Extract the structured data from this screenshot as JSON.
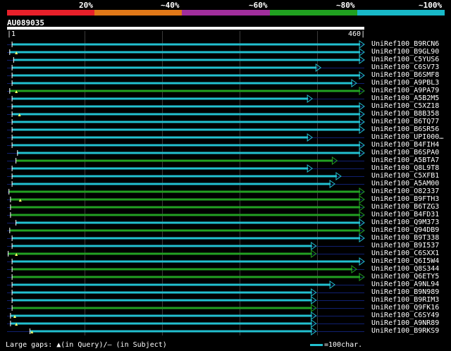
{
  "legend": {
    "segments": [
      {
        "color": "#e8202a"
      },
      {
        "color": "#e07818"
      },
      {
        "color": "#a02e9c"
      },
      {
        "color": "#20a020"
      },
      {
        "color": "#18b8c8"
      }
    ],
    "labels": [
      "20%",
      "~40%",
      "~60%",
      "~80%",
      "~100%"
    ]
  },
  "query": {
    "id": "AU089035",
    "start_label": "1",
    "end_label": "460",
    "length": 460
  },
  "colors": {
    "cyan": "#22c0d0",
    "green": "#22a022",
    "row_line": "#102070",
    "background": "#000000"
  },
  "hits": [
    {
      "label": "UniRef100_B9RCN6",
      "start": 6,
      "end": 460,
      "color": "cyan",
      "arrow": true,
      "gap_q": null
    },
    {
      "label": "UniRef100_B9GL90",
      "start": 3,
      "end": 460,
      "color": "cyan",
      "arrow": true,
      "gap_q": 12
    },
    {
      "label": "UniRef100_C5YUS6",
      "start": 8,
      "end": 460,
      "color": "cyan",
      "arrow": true,
      "gap_q": null
    },
    {
      "label": "UniRef100_C6SV73",
      "start": 6,
      "end": 404,
      "color": "cyan",
      "arrow": true,
      "gap_q": null
    },
    {
      "label": "UniRef100_B6SMF8",
      "start": 6,
      "end": 460,
      "color": "cyan",
      "arrow": true,
      "gap_q": null
    },
    {
      "label": "UniRef100_A9PBL3",
      "start": 6,
      "end": 450,
      "color": "cyan",
      "arrow": true,
      "gap_q": null
    },
    {
      "label": "UniRef100_A9PA79",
      "start": 3,
      "end": 460,
      "color": "green",
      "arrow": true,
      "gap_q": 12
    },
    {
      "label": "UniRef100_A5B2M5",
      "start": 6,
      "end": 393,
      "color": "cyan",
      "arrow": true,
      "gap_q": null
    },
    {
      "label": "UniRef100_C5XZ18",
      "start": 6,
      "end": 460,
      "color": "cyan",
      "arrow": true,
      "gap_q": null
    },
    {
      "label": "UniRef100_B8B358",
      "start": 6,
      "end": 460,
      "color": "cyan",
      "arrow": true,
      "gap_q": 16
    },
    {
      "label": "UniRef100_B6TQ77",
      "start": 6,
      "end": 460,
      "color": "cyan",
      "arrow": true,
      "gap_q": null
    },
    {
      "label": "UniRef100_B6SR56",
      "start": 6,
      "end": 460,
      "color": "cyan",
      "arrow": true,
      "gap_q": null
    },
    {
      "label": "UniRef100_UPI000…",
      "start": 6,
      "end": 393,
      "color": "cyan",
      "arrow": true,
      "gap_q": null
    },
    {
      "label": "UniRef100_B4FIH4",
      "start": 6,
      "end": 460,
      "color": "cyan",
      "arrow": true,
      "gap_q": null
    },
    {
      "label": "UniRef100_B6SPA0",
      "start": 13,
      "end": 460,
      "color": "cyan",
      "arrow": true,
      "gap_q": null
    },
    {
      "label": "UniRef100_A5BTA7",
      "start": 11,
      "end": 425,
      "color": "green",
      "arrow": true,
      "gap_q": null
    },
    {
      "label": "UniRef100_Q8L9T8",
      "start": 6,
      "end": 393,
      "color": "cyan",
      "arrow": true,
      "gap_q": null
    },
    {
      "label": "UniRef100_C5XFB1",
      "start": 6,
      "end": 430,
      "color": "cyan",
      "arrow": true,
      "gap_q": null
    },
    {
      "label": "UniRef100_A5AM00",
      "start": 6,
      "end": 422,
      "color": "cyan",
      "arrow": true,
      "gap_q": null
    },
    {
      "label": "UniRef100_O82337",
      "start": 2,
      "end": 460,
      "color": "green",
      "arrow": true,
      "gap_q": null
    },
    {
      "label": "UniRef100_B9FTH3",
      "start": 4,
      "end": 460,
      "color": "green",
      "arrow": true,
      "gap_q": 17
    },
    {
      "label": "UniRef100_B6TZG3",
      "start": 4,
      "end": 460,
      "color": "green",
      "arrow": true,
      "gap_q": null
    },
    {
      "label": "UniRef100_B4FD31",
      "start": 4,
      "end": 460,
      "color": "green",
      "arrow": true,
      "gap_q": null
    },
    {
      "label": "UniRef100_Q9M373",
      "start": 11,
      "end": 460,
      "color": "cyan",
      "arrow": true,
      "gap_q": null
    },
    {
      "label": "UniRef100_Q94DB9",
      "start": 3,
      "end": 460,
      "color": "green",
      "arrow": true,
      "gap_q": null
    },
    {
      "label": "UniRef100_B9T338",
      "start": 6,
      "end": 460,
      "color": "cyan",
      "arrow": true,
      "gap_q": null
    },
    {
      "label": "UniRef100_B9I537",
      "start": 6,
      "end": 398,
      "color": "cyan",
      "arrow": true,
      "gap_q": null
    },
    {
      "label": "UniRef100_C6SXX1",
      "start": 1,
      "end": 398,
      "color": "green",
      "arrow": true,
      "gap_q": 12
    },
    {
      "label": "UniRef100_Q6I5W4",
      "start": 6,
      "end": 460,
      "color": "cyan",
      "arrow": true,
      "gap_q": null
    },
    {
      "label": "UniRef100_Q8S344",
      "start": 6,
      "end": 450,
      "color": "green",
      "arrow": true,
      "gap_q": null
    },
    {
      "label": "UniRef100_Q6ETY5",
      "start": 6,
      "end": 460,
      "color": "green",
      "arrow": true,
      "gap_q": null
    },
    {
      "label": "UniRef100_A9NL94",
      "start": 6,
      "end": 422,
      "color": "cyan",
      "arrow": true,
      "gap_q": null
    },
    {
      "label": "UniRef100_B9N989",
      "start": 6,
      "end": 398,
      "color": "cyan",
      "arrow": true,
      "gap_q": null
    },
    {
      "label": "UniRef100_B9RIM3",
      "start": 6,
      "end": 398,
      "color": "cyan",
      "arrow": true,
      "gap_q": null
    },
    {
      "label": "UniRef100_Q9FK16",
      "start": 6,
      "end": 398,
      "color": "green",
      "arrow": true,
      "gap_q": null
    },
    {
      "label": "UniRef100_C6SY49",
      "start": 4,
      "end": 398,
      "color": "cyan",
      "arrow": true,
      "gap_q": 10
    },
    {
      "label": "UniRef100_A9NR89",
      "start": 4,
      "end": 398,
      "color": "cyan",
      "arrow": true,
      "gap_q": 12
    },
    {
      "label": "UniRef100_B9RKS9",
      "start": 29,
      "end": 398,
      "color": "cyan",
      "arrow": true,
      "gap_q": 32
    }
  ],
  "footer": {
    "gaps_text": "Large gaps: ▲(in Query)/— (in Subject)",
    "scale_text": "=100char."
  }
}
